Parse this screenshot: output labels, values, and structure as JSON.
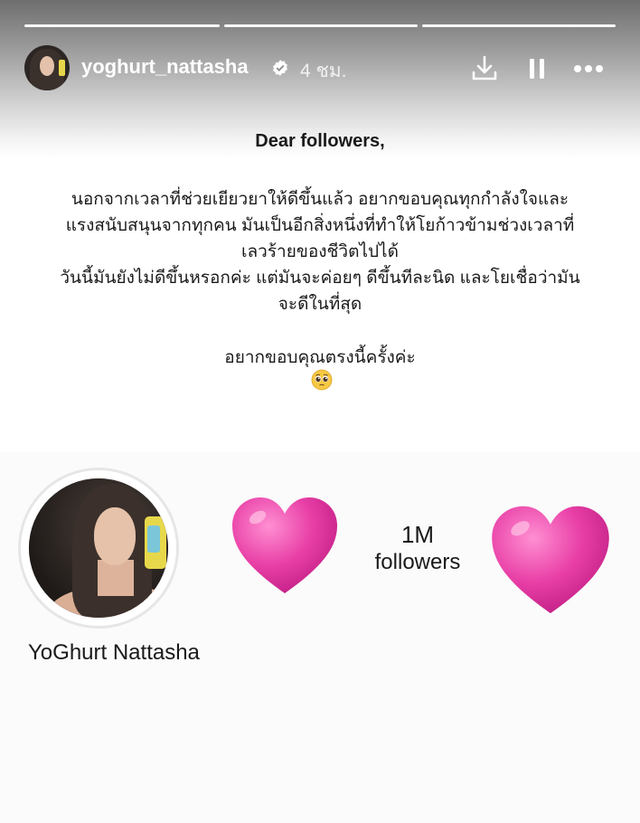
{
  "story": {
    "progress_segments": 3,
    "header": {
      "username": "yoghurt_nattasha",
      "verified": true,
      "time_ago": "4 ชม.",
      "actions": [
        {
          "name": "download-icon"
        },
        {
          "name": "pause-icon"
        },
        {
          "name": "more-icon"
        }
      ]
    },
    "content": {
      "greeting": "Dear followers,",
      "body_lines": [
        "นอกจากเวลาที่ช่วยเยียวยาให้ดีขึ้นแล้ว อยากขอบคุณทุกกำลังใจและ",
        "แรงสนับสนุนจากทุกคน มันเป็นอีกสิ่งหนึ่งที่ทำให้โยก้าวข้ามช่วงเวลาที่",
        "เลวร้ายของชีวิตไปได้",
        "วันนี้มันยังไม่ดีขึ้นหรอกค่ะ แต่มันจะค่อยๆ ดีขึ้นทีละนิด และโยเชื่อว่ามัน",
        "จะดีในที่สุด"
      ],
      "closing": "อยากขอบคุณตรงนี้ครั้งค่ะ",
      "emoji": "pleading-face"
    },
    "milestone": {
      "display_name": "YoGhurt Nattasha",
      "followers_count": "1M",
      "followers_label": "followers",
      "heart_color": "#e83fa6"
    }
  }
}
